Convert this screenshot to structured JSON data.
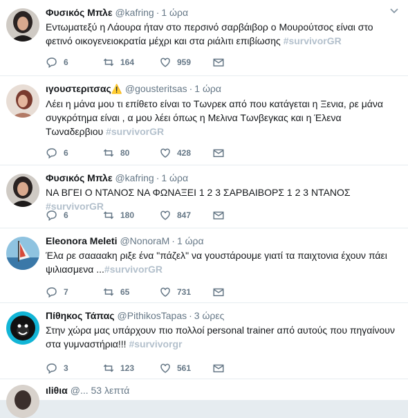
{
  "tweets": [
    {
      "fullname": "Φυσικός Μπλε",
      "username": "@kafring",
      "dot": "·",
      "time": "1 ώρα",
      "text": "Εντωματεξύ η Λάουρα ήταν στο περσινό σαρβάιβορ ο Μουρούτσος είναι στο φετινό οικογενειοκρατία μέχρι και στα ριάλιτι επιβίωσης",
      "hashtag": "#survivorGR",
      "replies": "6",
      "retweets": "164",
      "likes": "959"
    },
    {
      "fullname": "ιγουστεριτσας",
      "warning_emoji": "⚠️",
      "username": "@gousteritsas",
      "dot": "·",
      "time": "1 ώρα",
      "text": "Λέει η μάνα μου τι επίθετο είναι το Τωνρεκ από που κατάγεται η Ξενια, ρε μάνα συγκρότημα είναι , α μου λέει όπως η Μελινα Τωνβεγκας και η Έλενα Τωναδερβιου",
      "hashtag": "#survivorGR",
      "replies": "6",
      "retweets": "80",
      "likes": "428"
    },
    {
      "fullname": "Φυσικός Μπλε",
      "username": "@kafring",
      "dot": "·",
      "time": "1 ώρα",
      "text": "ΝΑ ΒΓΕΙ Ο ΝΤΑΝΟΣ ΝΑ ΦΩΝΑΞΕΙ 1 2 3 ΣΑΡΒΑΙΒΟΡΣ 1 2 3 ΝΤΑΝΟΣ",
      "hashtag": "#survivorGR",
      "replies": "6",
      "retweets": "180",
      "likes": "847"
    },
    {
      "fullname": "Eleonora Meleti",
      "username": "@NonoraM",
      "dot": "·",
      "time": "1 ώρα",
      "text": "Έλα ρε σααααkη ριξε ένα \"πάζελ\" να γουστάρουμε γιατί τα παιχτονια έχουν πάει ψιλιασμενα ...",
      "hashtag": "#survivorGR",
      "replies": "7",
      "retweets": "65",
      "likes": "731"
    },
    {
      "fullname": "Πίθηκος Τάπας",
      "username": "@PithikosTapas",
      "dot": "·",
      "time": "3 ώρες",
      "text": "Στην χώρα μας υπάρχουν πιο πολλοί personal trainer από αυτούς που πηγαίνουν στα γυμναστήρια!!!",
      "hashtag": "#survivorgr",
      "replies": "3",
      "retweets": "123",
      "likes": "561"
    }
  ],
  "partial_tweet": {
    "fullname": "ιliθια",
    "username": "@...",
    "time": "53 λεπτά"
  },
  "colors": {
    "hashtag": "#b3c0cc",
    "secondary_text": "#657786",
    "divider": "#e6ecf0"
  }
}
